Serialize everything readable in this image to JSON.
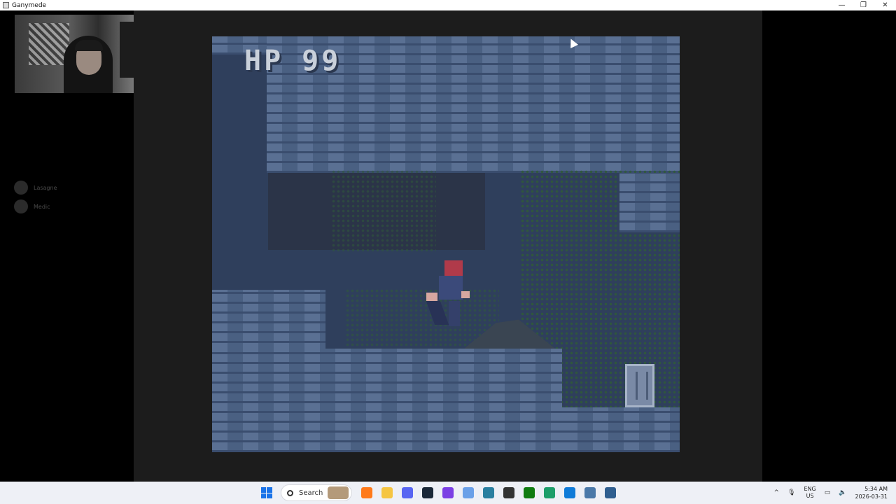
{
  "window": {
    "title": "Ganymede",
    "minimize_glyph": "—",
    "restore_glyph": "❐",
    "close_glyph": "✕"
  },
  "overlay": {
    "viewers": [
      {
        "name": "Lasagne"
      },
      {
        "name": "Medic"
      }
    ]
  },
  "game": {
    "hud_label": "HP",
    "hp_value": "99"
  },
  "taskbar": {
    "search_label": "Search",
    "up_arrow": "^",
    "language": "ENG",
    "region": "US",
    "time": "5:34 AM",
    "date": "2026-03-31",
    "apps": [
      {
        "name": "firefox-icon",
        "color": "#ff7a1a"
      },
      {
        "name": "file-explorer-icon",
        "color": "#f5c542"
      },
      {
        "name": "discord-icon",
        "color": "#5865f2"
      },
      {
        "name": "steam-icon",
        "color": "#1b2838"
      },
      {
        "name": "headset-app-icon",
        "color": "#7b3fe4"
      },
      {
        "name": "arrow-app-icon",
        "color": "#6aa0e8"
      },
      {
        "name": "game-app-icon",
        "color": "#2a7fa0"
      },
      {
        "name": "obs-icon",
        "color": "#333333"
      },
      {
        "name": "xbox-icon",
        "color": "#107c10"
      },
      {
        "name": "chat-app-icon",
        "color": "#1d9e6a"
      },
      {
        "name": "edge-icon",
        "color": "#0f7bd8"
      },
      {
        "name": "calculator-icon",
        "color": "#4a78a8"
      },
      {
        "name": "emulator-app-icon",
        "color": "#2f5e8f"
      }
    ]
  }
}
